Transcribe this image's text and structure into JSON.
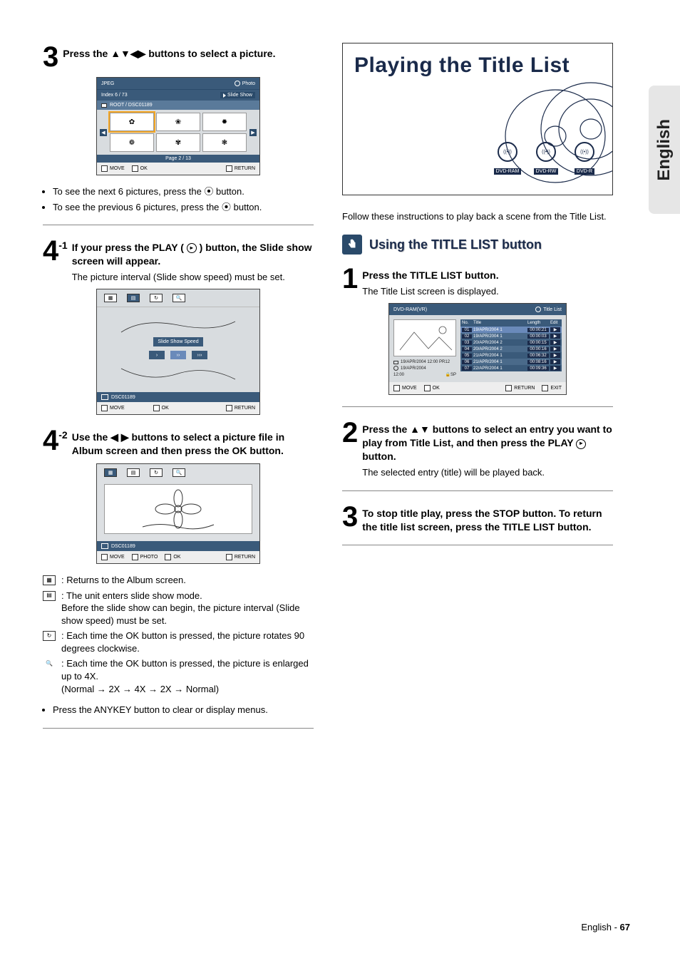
{
  "side_tab": "English",
  "left": {
    "step3": {
      "num": "3",
      "text_a": "Press the ",
      "arrows": "▲▼◀▶",
      "text_b": " buttons to select a picture."
    },
    "panel1": {
      "head_l": "JPEG",
      "head_r": "Photo",
      "sub_l": "Index    6   /    73",
      "sub_r": "Slide Show",
      "crumb": "ROOT / DSC01189",
      "pager": "Page    2    /    13",
      "foot": {
        "move": "MOVE",
        "ok": "OK",
        "return": "RETURN"
      }
    },
    "bullets_a": [
      "To see the next 6 pictures, press the  ⦿  button.",
      "To see the previous 6 pictures, press the  ⦿  button."
    ],
    "step4a": {
      "num": "4",
      "sub": "-1",
      "bold": "If your press the PLAY (   ) button, the Slide show screen will appear.",
      "note": "The picture interval (Slide show speed) must be set."
    },
    "panel2": {
      "banner": "Slide Show Speed",
      "dsc": "DSC01189",
      "foot": {
        "move": "MOVE",
        "ok": "OK",
        "return": "RETURN"
      }
    },
    "step4b": {
      "num": "4",
      "sub": "-2",
      "bold": "Use the ◀ ▶ buttons to select a picture file in Album screen and then press the OK button."
    },
    "panel3": {
      "dsc": "DSC01189",
      "foot": {
        "move": "MOVE",
        "photo": "PHOTO",
        "ok": "OK",
        "return": "RETURN"
      }
    },
    "iconlist": [
      ": Returns to the Album screen.",
      ": The unit enters slide show mode.\nBefore the slide show can begin, the picture interval (Slide show speed) must be set.",
      ": Each time the OK button is pressed, the picture rotates 90 degrees clockwise.",
      ": Each time the OK button is pressed, the picture is enlarged up to 4X.\n(Normal → 2X → 4X → 2X → Normal)"
    ],
    "bullet_final": "Press the ANYKEY button to clear or display menus."
  },
  "right": {
    "title": "Playing the Title List",
    "badges": [
      "DVD-RAM",
      "DVD-RW",
      "DVD-R"
    ],
    "intro": "Follow these instructions to play back a scene from the Title List.",
    "subhead": "Using the TITLE LIST button",
    "step1": {
      "num": "1",
      "bold": "Press the TITLE LIST button.",
      "note": "The Title List screen is displayed."
    },
    "panel": {
      "head_l": "DVD-RAM(VR)",
      "head_r": "Title List",
      "hdr": {
        "no": "No.",
        "title": "Title",
        "length": "Length",
        "edit": "Edit"
      },
      "rows": [
        {
          "n": "01",
          "t": "19/APR/2004 1",
          "len": "00:00:21"
        },
        {
          "n": "02",
          "t": "19/APR/2004 1",
          "len": "00:00:03"
        },
        {
          "n": "03",
          "t": "20/APR/2004 2",
          "len": "00:00:15"
        },
        {
          "n": "04",
          "t": "20/APR/2004 2",
          "len": "00:00:16"
        },
        {
          "n": "05",
          "t": "21/APR/2004 1",
          "len": "00:06:32"
        },
        {
          "n": "06",
          "t": "21/APR/2004 1",
          "len": "00:08:16"
        },
        {
          "n": "07",
          "t": "22/APR/2004 1",
          "len": "00:09:36"
        }
      ],
      "info": {
        "l1": "19/APR/2004 12:00 PR12",
        "l2": "19/APR/2004",
        "l3a": "12:00",
        "l3b": "SP"
      },
      "foot": {
        "move": "MOVE",
        "ok": "OK",
        "return": "RETURN",
        "exit": "EXIT"
      }
    },
    "step2": {
      "num": "2",
      "bold": "Press the ▲▼ buttons to select an entry you want to play from Title List, and then press the PLAY      button.",
      "note": "The selected entry (title) will be played back."
    },
    "step3": {
      "num": "3",
      "bold": "To stop title play, press the STOP button. To return the title list screen, press the TITLE LIST button."
    }
  },
  "footer": {
    "lang": "English - ",
    "page": "67"
  }
}
